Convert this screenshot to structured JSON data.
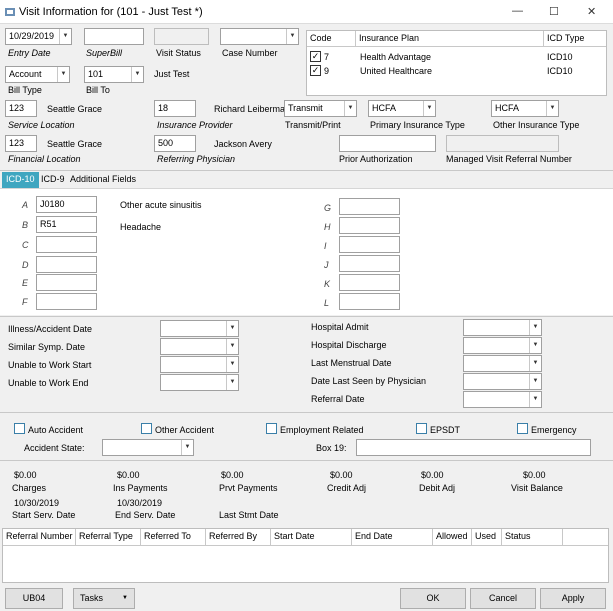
{
  "window": {
    "title": "Visit Information for (101 - Just Test *)",
    "minimize": "—",
    "maximize": "☐",
    "close": "✕",
    "icon": "app-icon"
  },
  "header": {
    "entry_date": "10/29/2019",
    "entry_date_label": "Entry Date",
    "superbill": "",
    "superbill_label": "SuperBill",
    "visit_status_label": "Visit Status",
    "case_number_label": "Case Number",
    "bill_type": "Account",
    "bill_type_label": "Bill Type",
    "bill_to": "101",
    "bill_to_name": "Just Test",
    "bill_to_label": "Bill To",
    "service_location_code": "123",
    "service_location_name": "Seattle Grace",
    "service_location_label": "Service Location",
    "insurance_provider_code": "18",
    "insurance_provider_name": "Richard  Leiberman",
    "insurance_provider_label": "Insurance Provider",
    "transmit_print": "Transmit",
    "transmit_print_label": "Transmit/Print",
    "primary_insurance_type": "HCFA",
    "primary_insurance_type_label": "Primary Insurance Type",
    "other_insurance_type": "HCFA",
    "other_insurance_type_label": "Other Insurance Type",
    "financial_location_code": "123",
    "financial_location_name": "Seattle Grace",
    "financial_location_label": "Financial Location",
    "referring_physician_code": "500",
    "referring_physician_name": "Jackson Avery",
    "referring_physician_label": "Referring Physician",
    "prior_authorization_label": "Prior Authorization",
    "managed_visit_label": "Managed Visit Referral Number"
  },
  "insurance_table": {
    "headers": [
      "Code",
      "Insurance Plan",
      "ICD Type"
    ],
    "rows": [
      {
        "checked": "✓",
        "code": "7",
        "plan": "Health Advantage",
        "icd": "ICD10"
      },
      {
        "checked": "✓",
        "code": "9",
        "plan": "United Healthcare",
        "icd": "ICD10"
      }
    ]
  },
  "tabs": [
    "ICD-10",
    "ICD-9",
    "Additional Fields"
  ],
  "icd": {
    "left": [
      {
        "letter": "A",
        "code": "J0180",
        "desc": "Other acute sinusitis"
      },
      {
        "letter": "B",
        "code": "R51",
        "desc": "Headache"
      },
      {
        "letter": "C",
        "code": "",
        "desc": ""
      },
      {
        "letter": "D",
        "code": "",
        "desc": ""
      },
      {
        "letter": "E",
        "code": "",
        "desc": ""
      },
      {
        "letter": "F",
        "code": "",
        "desc": ""
      }
    ],
    "right": [
      "G",
      "H",
      "I",
      "J",
      "K",
      "L"
    ]
  },
  "dates_left": [
    "Illness/Accident Date",
    "Similar Symp. Date",
    "Unable to Work Start",
    "Unable to Work End"
  ],
  "dates_right": [
    "Hospital Admit",
    "Hospital Discharge",
    "Last Menstrual Date",
    "Date Last Seen by Physician",
    "Referral Date"
  ],
  "checkboxes": [
    "Auto Accident",
    "Other Accident",
    "Employment Related",
    "EPSDT",
    "Emergency"
  ],
  "accident_state_label": "Accident State:",
  "box19_label": "Box 19:",
  "totals": [
    {
      "value": "$0.00",
      "label": "Charges"
    },
    {
      "value": "$0.00",
      "label": "Ins Payments"
    },
    {
      "value": "$0.00",
      "label": "Prvt Payments"
    },
    {
      "value": "$0.00",
      "label": "Credit Adj"
    },
    {
      "value": "$0.00",
      "label": "Debit Adj"
    },
    {
      "value": "$0.00",
      "label": "Visit Balance"
    }
  ],
  "serv_dates": [
    {
      "value": "10/30/2019",
      "label": "Start Serv. Date"
    },
    {
      "value": "10/30/2019",
      "label": "End Serv. Date"
    },
    {
      "value": "",
      "label": "Last Stmt Date"
    }
  ],
  "referral_table_headers": [
    "Referral Number",
    "Referral Type",
    "Referred To",
    "Referred By",
    "Start Date",
    "End Date",
    "Allowed",
    "Used",
    "Status"
  ],
  "buttons": {
    "ub04": "UB04",
    "tasks": "Tasks",
    "ok": "OK",
    "cancel": "Cancel",
    "apply": "Apply"
  },
  "colors": {
    "tab_active": "#3fa6c0",
    "checkbox_border": "#3a7fa8"
  }
}
